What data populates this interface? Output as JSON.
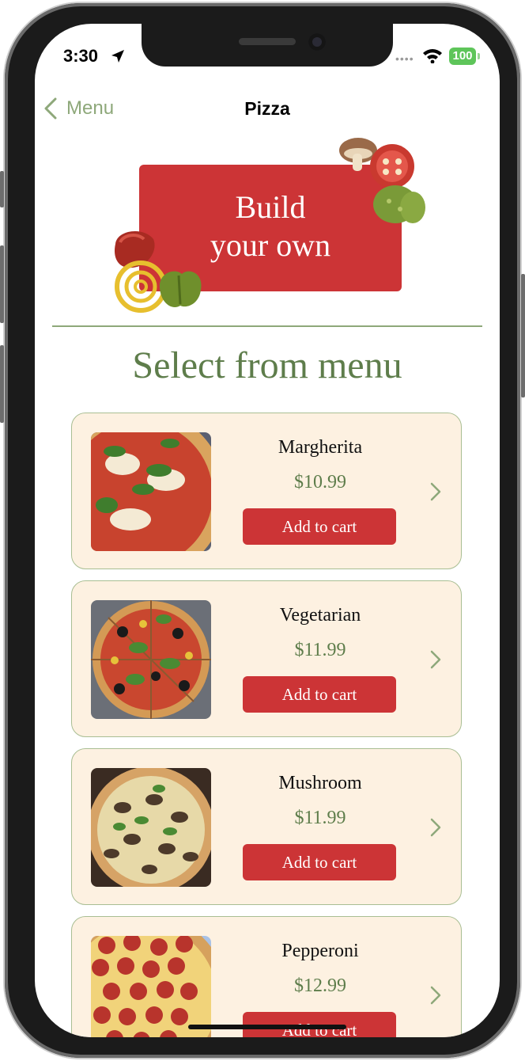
{
  "status_bar": {
    "time": "3:30",
    "battery": "100"
  },
  "nav": {
    "back_label": "Menu",
    "title": "Pizza"
  },
  "build_your_own": {
    "line1": "Build",
    "line2": "your own"
  },
  "section_title": "Select from menu",
  "items": [
    {
      "name": "Margherita",
      "price": "$10.99",
      "button": "Add to cart"
    },
    {
      "name": "Vegetarian",
      "price": "$11.99",
      "button": "Add to cart"
    },
    {
      "name": "Mushroom",
      "price": "$11.99",
      "button": "Add to cart"
    },
    {
      "name": "Pepperoni",
      "price": "$12.99",
      "button": "Add to cart"
    }
  ],
  "colors": {
    "accent_red": "#cc3436",
    "accent_green": "#5e7d4b",
    "card_background": "#fdf1e1",
    "card_border": "#a9be93"
  },
  "icons": [
    "location-arrow-icon",
    "wifi-icon",
    "battery-icon",
    "back-chevron-icon",
    "chevron-right-icon"
  ]
}
